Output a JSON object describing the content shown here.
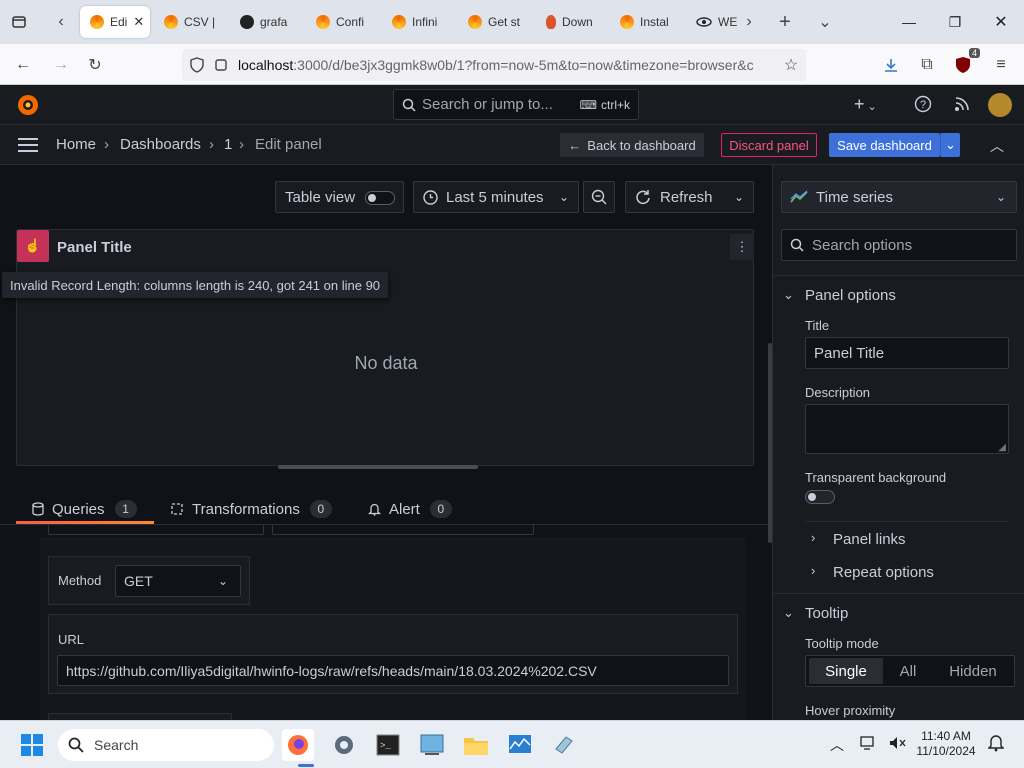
{
  "browser": {
    "tabs": [
      {
        "label": "Edi",
        "active": true,
        "icon": "grafana-logo-icon"
      },
      {
        "label": "CSV |",
        "icon": "grafana-logo-icon"
      },
      {
        "label": "grafa",
        "icon": "github-icon"
      },
      {
        "label": "Confi",
        "icon": "grafana-logo-icon"
      },
      {
        "label": "Infini",
        "icon": "grafana-logo-icon"
      },
      {
        "label": "Get st",
        "icon": "grafana-logo-icon"
      },
      {
        "label": "Down",
        "icon": "download-site-icon"
      },
      {
        "label": "Instal",
        "icon": "grafana-logo-icon"
      },
      {
        "label": "WE",
        "icon": "eye-icon"
      }
    ],
    "url_host": "localhost",
    "url_rest": ":3000/d/be3jx3ggmk8w0b/1?from=now-5m&to=now&timezone=browser&c",
    "extension_badge": "4"
  },
  "grafana": {
    "search_placeholder": "Search or jump to...",
    "search_shortcut": "ctrl+k",
    "breadcrumb": [
      "Home",
      "Dashboards",
      "1",
      "Edit panel"
    ],
    "back_button": "Back to dashboard",
    "discard_button": "Discard panel",
    "save_button": "Save dashboard",
    "toolbar": {
      "table_view": "Table view",
      "time_range": "Last 5 minutes",
      "refresh": "Refresh"
    },
    "panel": {
      "title": "Panel Title",
      "error": "Invalid Record Length: columns length is 240, got 241 on line 90",
      "no_data": "No data"
    },
    "query_tabs": [
      {
        "label": "Queries",
        "count": "1"
      },
      {
        "label": "Transformations",
        "count": "0"
      },
      {
        "label": "Alert",
        "count": "0"
      }
    ],
    "query": {
      "method_label": "Method",
      "method_value": "GET",
      "url_label": "URL",
      "url_value": "https://github.com/Iliya5digital/hwinfo-logs/raw/refs/heads/main/18.03.2024%202.CSV"
    },
    "options": {
      "viz_type": "Time series",
      "search_placeholder": "Search options",
      "panel_options": "Panel options",
      "title_label": "Title",
      "title_value": "Panel Title",
      "description_label": "Description",
      "transparent_label": "Transparent background",
      "panel_links": "Panel links",
      "repeat_options": "Repeat options",
      "tooltip": "Tooltip",
      "tooltip_mode_label": "Tooltip mode",
      "tooltip_modes": [
        "Single",
        "All",
        "Hidden"
      ],
      "hover_label": "Hover proximity"
    },
    "colors": {
      "accent_blue": "#3d71d9",
      "discard_red": "#e0226e",
      "tab_underline": "#f55f3e",
      "panel_bg": "#181b1f",
      "page_bg": "#111217"
    }
  },
  "taskbar": {
    "search_placeholder": "Search",
    "time": "11:40 AM",
    "date": "11/10/2024"
  }
}
